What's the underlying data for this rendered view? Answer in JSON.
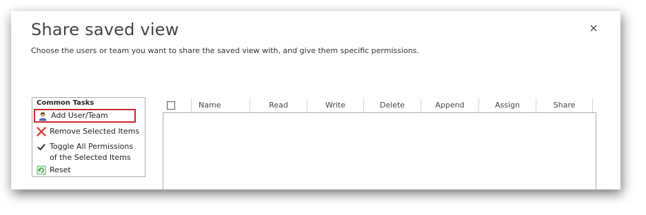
{
  "dialog": {
    "title": "Share saved view",
    "subtitle": "Choose the users or team you want to share the saved view with, and give them specific permissions.",
    "close_symbol": "×"
  },
  "tasks": {
    "header": "Common Tasks",
    "items": [
      {
        "label": "Add User/Team",
        "icon": "user-icon"
      },
      {
        "label": "Remove Selected Items",
        "icon": "red-x-icon"
      },
      {
        "label": "Toggle All Permissions of the Selected Items",
        "line1": "Toggle All Permissions",
        "line2": "of the Selected Items",
        "icon": "checkmark-icon"
      },
      {
        "label": "Reset",
        "icon": "refresh-icon"
      }
    ]
  },
  "grid": {
    "columns": [
      "Name",
      "Read",
      "Write",
      "Delete",
      "Append",
      "Assign",
      "Share"
    ]
  },
  "colors": {
    "highlight_border": "#c9262f",
    "remove_icon": "#d9443f",
    "reset_icon": "#3a9a3a"
  }
}
